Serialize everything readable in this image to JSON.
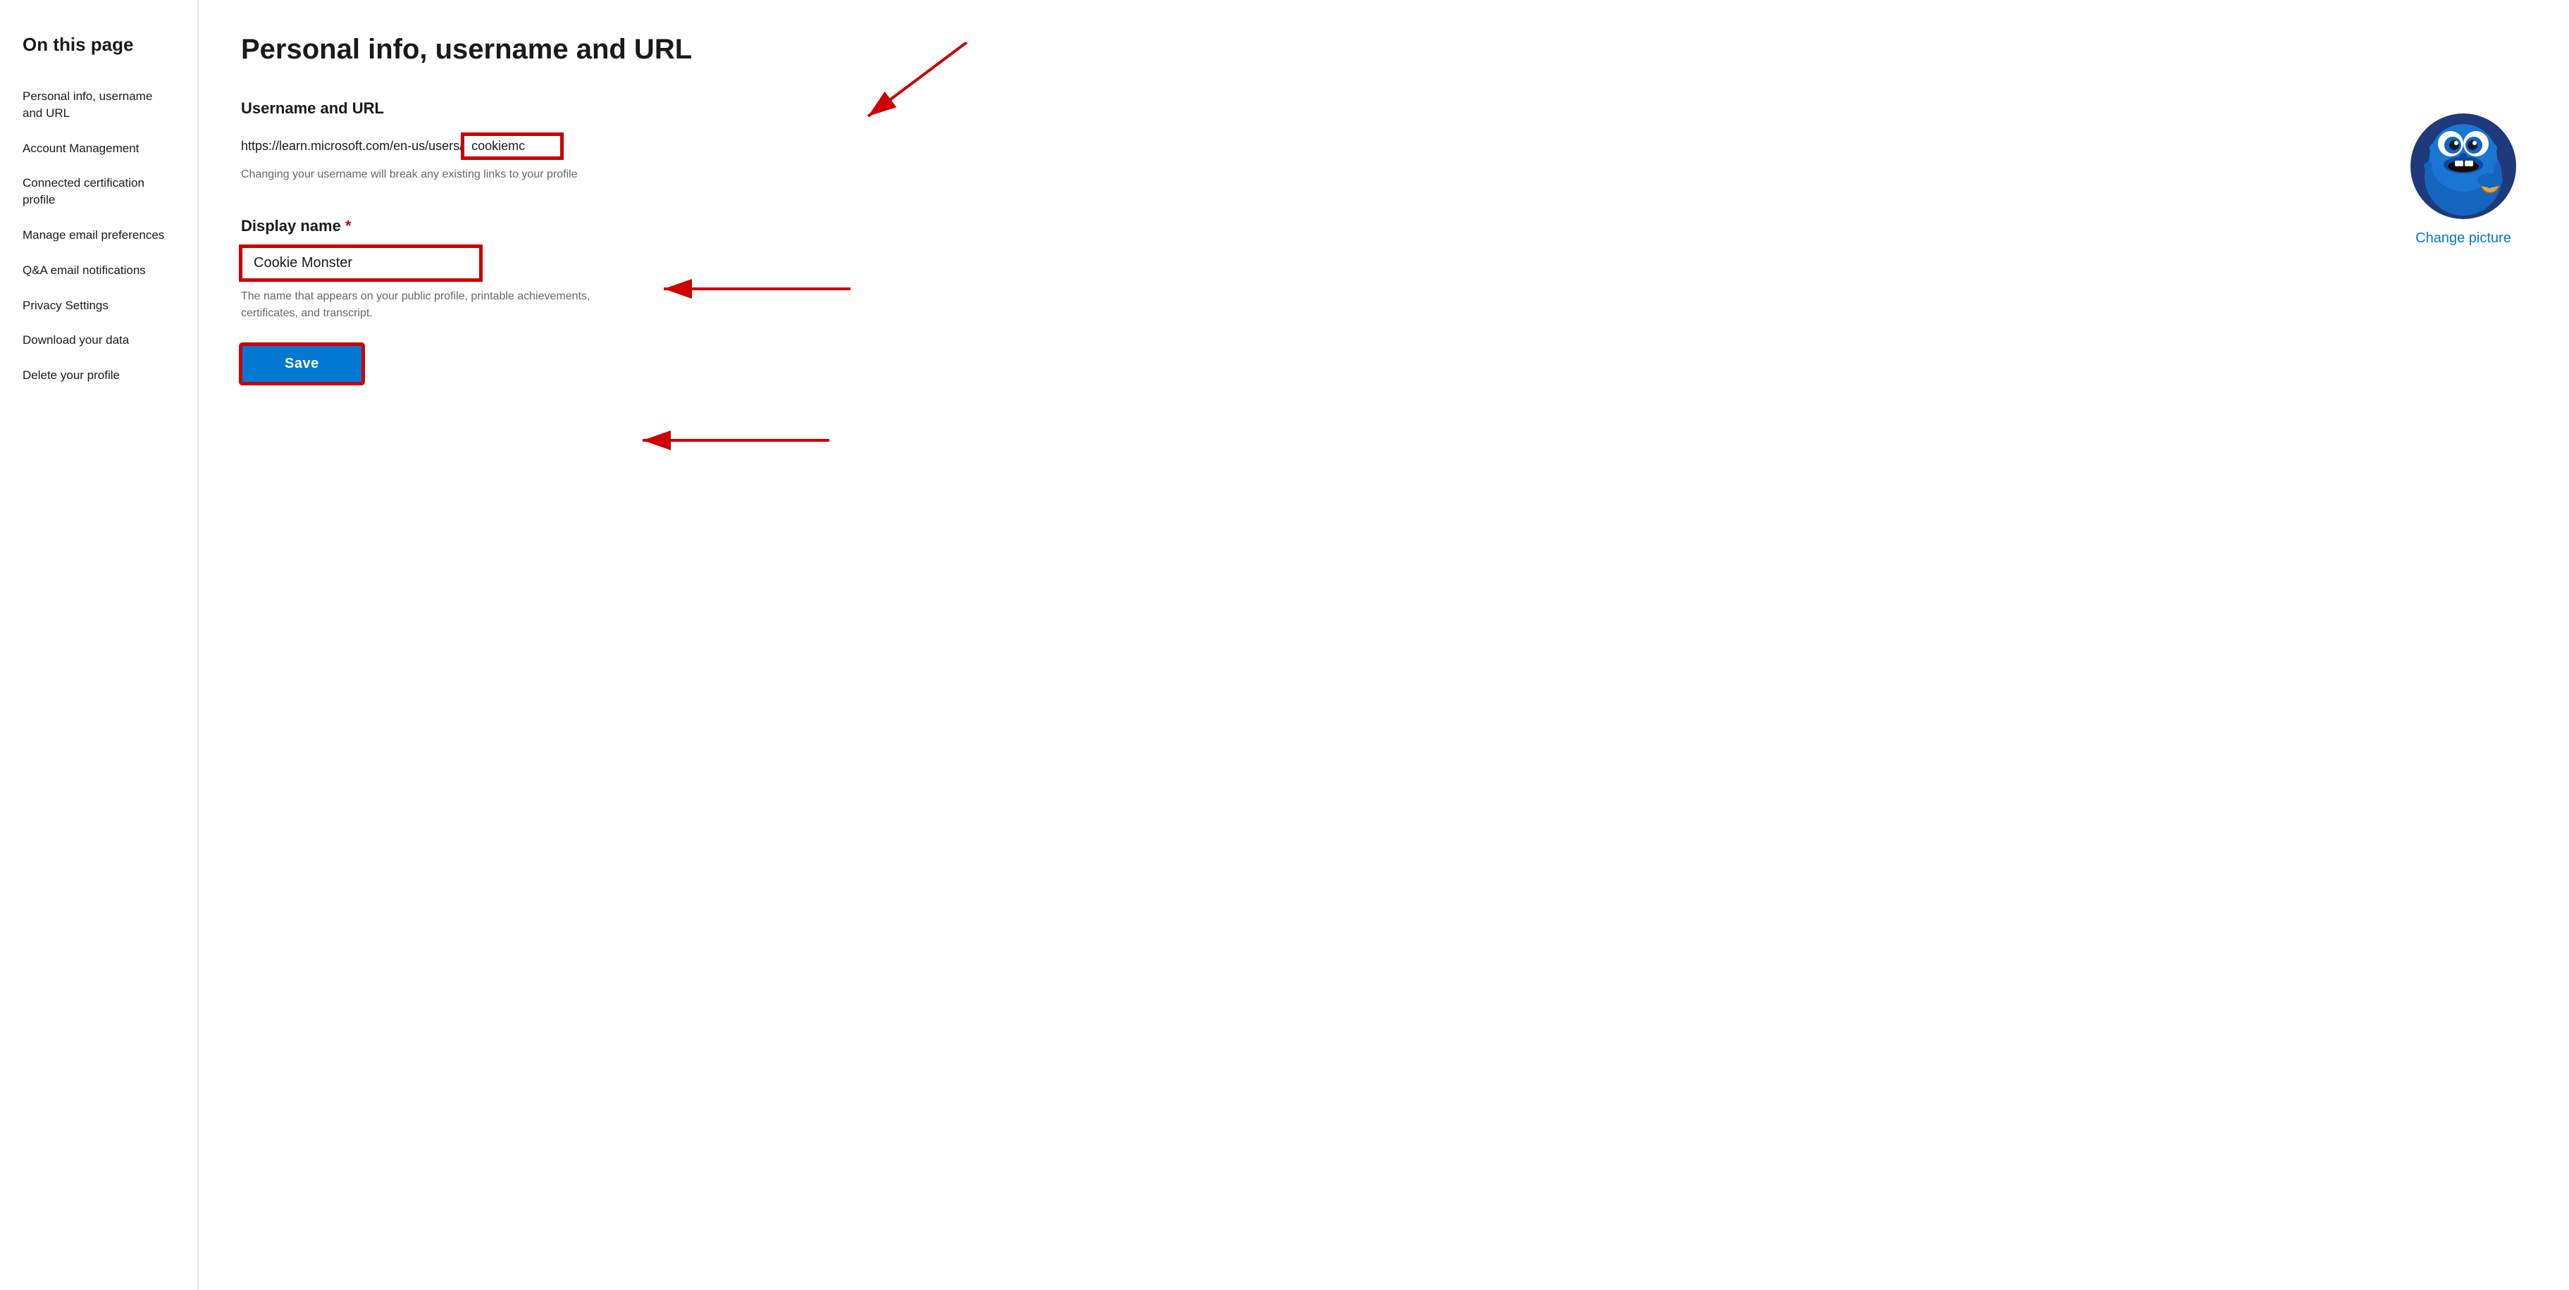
{
  "sidebar": {
    "title": "On this page",
    "items": [
      {
        "id": "personal-info",
        "label": "Personal info, username and URL"
      },
      {
        "id": "account-management",
        "label": "Account Management"
      },
      {
        "id": "connected-certification",
        "label": "Connected certification profile"
      },
      {
        "id": "manage-email",
        "label": "Manage email preferences"
      },
      {
        "id": "qa-notifications",
        "label": "Q&A email notifications"
      },
      {
        "id": "privacy-settings",
        "label": "Privacy Settings"
      },
      {
        "id": "download-data",
        "label": "Download your data"
      },
      {
        "id": "delete-profile",
        "label": "Delete your profile"
      }
    ]
  },
  "main": {
    "page_title": "Personal info, username and URL",
    "username_section": {
      "title": "Username and URL",
      "url_base": "https://learn.microsoft.com/en-us/users/",
      "username_value": "cookiemc",
      "hint": "Changing your username will break any existing links to your profile"
    },
    "display_name_section": {
      "label": "Display name",
      "required_marker": "*",
      "value": "Cookie Monster",
      "hint": "The name that appears on your public profile, printable achievements, certificates, and transcript."
    },
    "save_button": "Save",
    "change_picture_link": "Change picture"
  }
}
